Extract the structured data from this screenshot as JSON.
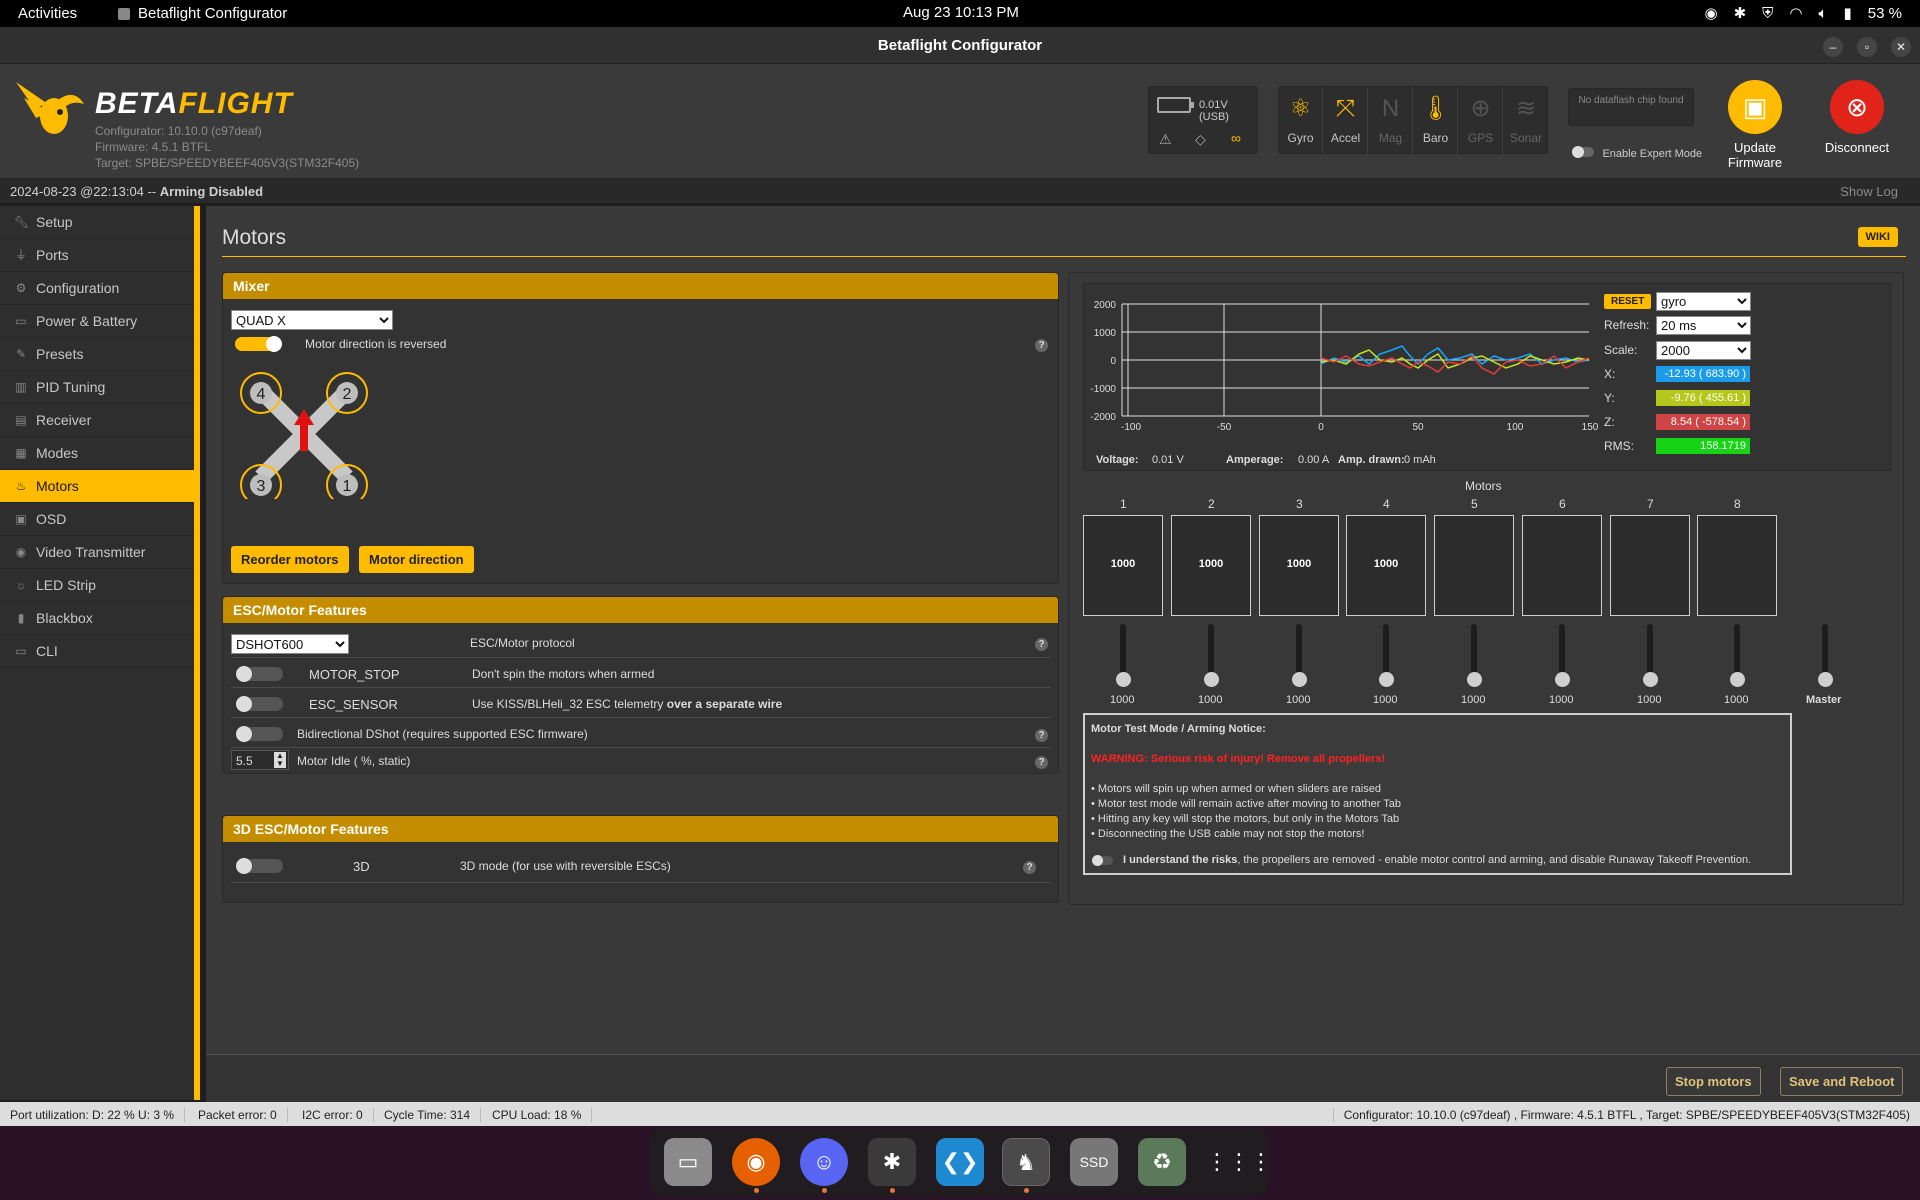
{
  "topbar": {
    "activities": "Activities",
    "app_name": "Betaflight Configurator",
    "clock": "Aug 23  10:13 PM",
    "battery": "53 %"
  },
  "window": {
    "title": "Betaflight Configurator"
  },
  "header": {
    "logo_beta": "BETA",
    "logo_flight": "FLIGHT",
    "configurator_version": "Configurator: 10.10.0 (c97deaf)",
    "firmware": "Firmware: 4.5.1 BTFL",
    "target": "Target: SPBE/SPEEDYBEEF405V3(STM32F405)",
    "voltage": "0.01V (USB)",
    "sensors": [
      {
        "label": "Gyro",
        "active": true,
        "icon": "gyro-icon"
      },
      {
        "label": "Accel",
        "active": true,
        "icon": "accel-icon"
      },
      {
        "label": "Mag",
        "active": false,
        "icon": "mag-icon"
      },
      {
        "label": "Baro",
        "active": true,
        "icon": "baro-icon"
      },
      {
        "label": "GPS",
        "active": false,
        "icon": "gps-icon"
      },
      {
        "label": "Sonar",
        "active": false,
        "icon": "sonar-icon"
      }
    ],
    "dataflash": "No dataflash chip found",
    "expert_mode": "Enable Expert Mode",
    "update_firmware": "Update Firmware",
    "disconnect": "Disconnect"
  },
  "logbar": {
    "timestamp": "2024-08-23 @22:13:04 -- ",
    "status": "Arming Disabled",
    "show_log": "Show Log"
  },
  "sidebar": {
    "items": [
      {
        "label": "Setup",
        "icon": "wrench-icon"
      },
      {
        "label": "Ports",
        "icon": "plug-icon"
      },
      {
        "label": "Configuration",
        "icon": "gear-icon"
      },
      {
        "label": "Power & Battery",
        "icon": "battery-icon"
      },
      {
        "label": "Presets",
        "icon": "presets-icon"
      },
      {
        "label": "PID Tuning",
        "icon": "pid-icon"
      },
      {
        "label": "Receiver",
        "icon": "receiver-icon"
      },
      {
        "label": "Modes",
        "icon": "modes-icon"
      },
      {
        "label": "Motors",
        "icon": "motors-icon"
      },
      {
        "label": "OSD",
        "icon": "osd-icon"
      },
      {
        "label": "Video Transmitter",
        "icon": "vtx-icon"
      },
      {
        "label": "LED Strip",
        "icon": "led-icon"
      },
      {
        "label": "Blackbox",
        "icon": "blackbox-icon"
      },
      {
        "label": "CLI",
        "icon": "cli-icon"
      }
    ],
    "active_index": 8
  },
  "main": {
    "title": "Motors",
    "wiki": "WIKI",
    "mixer": {
      "header": "Mixer",
      "type": "QUAD X",
      "reversed_label": "Motor direction is reversed",
      "reorder": "Reorder motors",
      "direction": "Motor direction"
    },
    "esc": {
      "header": "ESC/Motor Features",
      "protocol_value": "DSHOT600",
      "protocol_label": "ESC/Motor protocol",
      "motor_stop": "MOTOR_STOP",
      "motor_stop_desc": "Don't spin the motors when armed",
      "esc_sensor": "ESC_SENSOR",
      "esc_sensor_desc": "Use KISS/BLHeli_32 ESC telemetry ",
      "esc_sensor_desc_bold": "over a separate wire",
      "bidir": "Bidirectional DShot (requires supported ESC firmware)",
      "idle_value": "5.5",
      "idle_label": "Motor Idle ( %, static)"
    },
    "esc3d": {
      "header": "3D ESC/Motor Features",
      "label": "3D",
      "desc": "3D mode (for use with reversible ESCs)"
    },
    "graph": {
      "reset": "RESET",
      "sensor": "gyro",
      "refresh_label": "Refresh:",
      "refresh": "20 ms",
      "scale_label": "Scale:",
      "scale": "2000",
      "x_label": "X:",
      "x_value": "-12.93 ( 683.90 )",
      "y_label": "Y:",
      "y_value": "-9.76 ( 455.61 )",
      "z_label": "Z:",
      "z_value": "8.54 ( -578.54 )",
      "rms_label": "RMS:",
      "rms_value": "158.1719",
      "y_ticks": [
        "2000",
        "1000",
        "0",
        "-1000",
        "-2000"
      ],
      "x_ticks": [
        "-100",
        "-50",
        "0",
        "50",
        "100",
        "150"
      ],
      "voltage_label": "Voltage:",
      "voltage": "0.01 V",
      "amperage_label": "Amperage:",
      "amperage": "0.00 A",
      "drawn_label": "Amp. drawn:",
      "drawn": "0 mAh"
    },
    "motors": {
      "title": "Motors",
      "numbers": [
        "1",
        "2",
        "3",
        "4",
        "5",
        "6",
        "7",
        "8"
      ],
      "values": [
        "1000",
        "1000",
        "1000",
        "1000",
        "",
        "",
        "",
        ""
      ],
      "slider_values": [
        "1000",
        "1000",
        "1000",
        "1000",
        "1000",
        "1000",
        "1000",
        "1000"
      ],
      "master": "Master"
    },
    "notice": {
      "title": "Motor Test Mode / Arming Notice:",
      "warning": "WARNING: Serious risk of injury! Remove all propellers!",
      "lines": [
        "• Motors will spin up when armed or when sliders are raised",
        "• Motor test mode will remain active after moving to another Tab",
        "• Hitting any key will stop the motors, but only in the Motors Tab",
        "• Disconnecting the USB cable may not stop the motors!"
      ],
      "understand_bold": "I understand the risks",
      "understand_rest": ", the propellers are removed - enable motor control and arming, and disable Runaway Takeoff Prevention."
    }
  },
  "footer": {
    "stop": "Stop motors",
    "save": "Save and Reboot"
  },
  "status": {
    "port": "Port utilization: D: 22 % U: 3 %",
    "packet": "Packet error: 0",
    "i2c": "I2C error: 0",
    "cycle": "Cycle Time: 314",
    "cpu": "CPU Load: 18 %",
    "right": "Configurator: 10.10.0 (c97deaf) , Firmware: 4.5.1 BTFL , Target: SPBE/SPEEDYBEEF405V3(STM32F405)"
  },
  "dock": [
    {
      "name": "files-icon",
      "color": "#8a8a8a"
    },
    {
      "name": "firefox-icon",
      "color": "#e66000"
    },
    {
      "name": "discord-icon",
      "color": "#5865f2"
    },
    {
      "name": "slack-icon",
      "color": "#4a154b"
    },
    {
      "name": "vscode-icon",
      "color": "#1f8ad2"
    },
    {
      "name": "betaflight-icon",
      "color": "#3a3a3a"
    },
    {
      "name": "ssd-icon",
      "color": "#777"
    },
    {
      "name": "trash-icon",
      "color": "#5a7a5a"
    },
    {
      "name": "app-grid-icon",
      "color": "#2a2a2a"
    }
  ],
  "dock_ssd_label": "SSD"
}
